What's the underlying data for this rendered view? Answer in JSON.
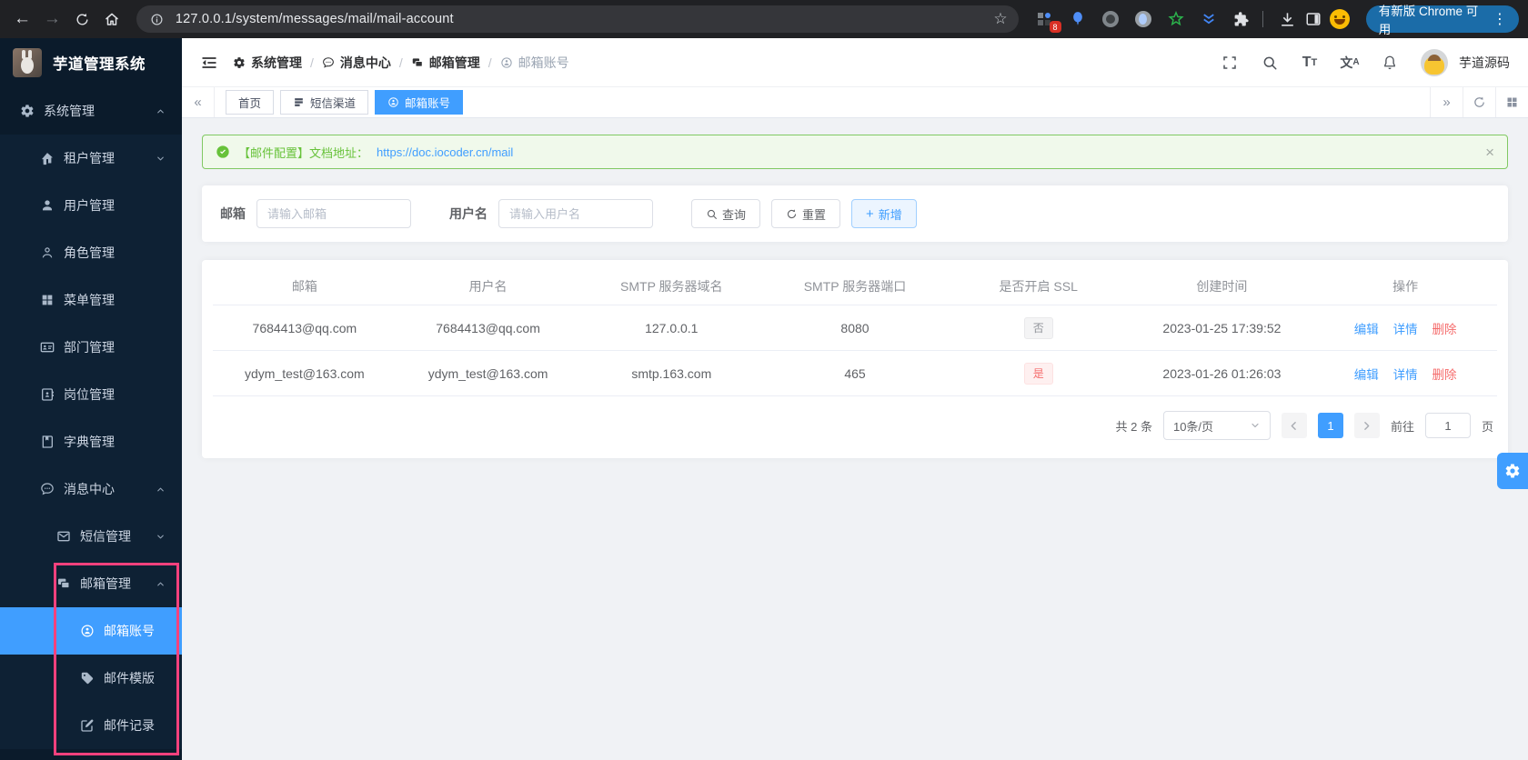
{
  "browser": {
    "url": "127.0.0.1/system/messages/mail/mail-account",
    "extension_badge": "8",
    "update_button_label": "有新版 Chrome 可用"
  },
  "glyphs": {
    "back": "←",
    "forward": "→",
    "star": "☆",
    "dots": "⋮",
    "collapse_left": "«",
    "expand_right": "»",
    "close": "×",
    "plus": "+",
    "crumb_sep": "/",
    "font_big": "T",
    "font_small": "T",
    "lang_cn": "文",
    "lang_a": "A"
  },
  "sidebar": {
    "logo_title": "芋道管理系统",
    "menu": {
      "system": "系统管理",
      "tenant": "租户管理",
      "user": "用户管理",
      "role": "角色管理",
      "menu": "菜单管理",
      "dept": "部门管理",
      "post": "岗位管理",
      "dict": "字典管理",
      "msg": "消息中心",
      "sms": "短信管理",
      "mail": "邮箱管理",
      "mail_account": "邮箱账号",
      "mail_template": "邮件模版",
      "mail_log": "邮件记录"
    }
  },
  "header": {
    "breadcrumb": [
      "系统管理",
      "消息中心",
      "邮箱管理",
      "邮箱账号"
    ],
    "user_name": "芋道源码"
  },
  "tabs": {
    "home": "首页",
    "sms_channel": "短信渠道",
    "mail_account": "邮箱账号"
  },
  "alert": {
    "message": "【邮件配置】文档地址：",
    "link": "https://doc.iocoder.cn/mail"
  },
  "filter": {
    "mail_label": "邮箱",
    "mail_placeholder": "请输入邮箱",
    "username_label": "用户名",
    "username_placeholder": "请输入用户名",
    "search_button": "查询",
    "reset_button": "重置",
    "add_button": "新增"
  },
  "table": {
    "columns": [
      "邮箱",
      "用户名",
      "SMTP 服务器域名",
      "SMTP 服务器端口",
      "是否开启 SSL",
      "创建时间",
      "操作"
    ],
    "rows": [
      {
        "mail": "7684413@qq.com",
        "username": "7684413@qq.com",
        "host": "127.0.0.1",
        "port": "8080",
        "ssl": "否",
        "create_time": "2023-01-25 17:39:52"
      },
      {
        "mail": "ydym_test@163.com",
        "username": "ydym_test@163.com",
        "host": "smtp.163.com",
        "port": "465",
        "ssl": "是",
        "create_time": "2023-01-26 01:26:03"
      }
    ],
    "actions": {
      "edit": "编辑",
      "detail": "详情",
      "delete": "删除"
    }
  },
  "pagination": {
    "total": "共 2 条",
    "page_size": "10条/页",
    "page": "1",
    "goto_label": "前往",
    "goto_value": "1",
    "unit_label": "页"
  },
  "colors": {
    "accent": "#409eff",
    "success": "#67c23a",
    "danger": "#f56c6c",
    "annotation": "#f5417d",
    "sidebar_bg": "#0b1b2b",
    "chrome_bar": "#202124",
    "update_pill": "#1b6ca8"
  }
}
